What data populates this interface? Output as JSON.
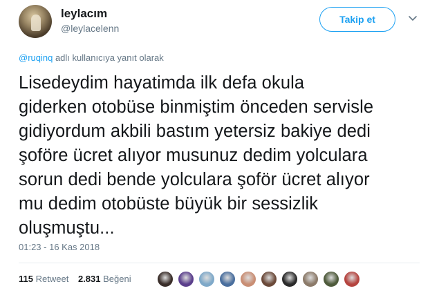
{
  "user": {
    "display_name": "leylacım",
    "handle": "@leylacelenn"
  },
  "follow_button": {
    "label": "Takip et"
  },
  "reply_context": {
    "mention": "@ruqinq",
    "suffix": " adlı kullanıcıya yanıt olarak"
  },
  "tweet": {
    "text": "Lisedeydim hayatimda ilk defa okula\ngiderken otobüse binmiştim önceden servisle\ngidiyordum akbili bastım yetersiz bakiye dedi\nşoföre ücret alıyor musunuz dedim yolculara\nsorun dedi bende yolculara şoför ücret alıyor\nmu dedim otobüste büyük bir sessizlik\noluşmuştu...",
    "timestamp": "01:23 - 16 Kas 2018"
  },
  "stats": {
    "retweet_count": "115",
    "retweet_label": "Retweet",
    "like_count": "2.831",
    "like_label": "Beğeni"
  },
  "colors": {
    "accent": "#1da1f2",
    "secondary_text": "#657786",
    "divider": "#e6ecf0"
  },
  "icons": {
    "menu": "chevron-down-icon"
  },
  "likers": [
    {
      "name": "liker-avatar",
      "color": "#3a2e2a"
    },
    {
      "name": "liker-avatar",
      "color": "#5b3f8c"
    },
    {
      "name": "liker-avatar",
      "color": "#7fa9c9"
    },
    {
      "name": "liker-avatar",
      "color": "#4a6f9e"
    },
    {
      "name": "liker-avatar",
      "color": "#c98e74"
    },
    {
      "name": "liker-avatar",
      "color": "#6b4a3a"
    },
    {
      "name": "liker-avatar",
      "color": "#2b2b2b"
    },
    {
      "name": "liker-avatar",
      "color": "#8c7b6a"
    },
    {
      "name": "liker-avatar",
      "color": "#4f5b3c"
    },
    {
      "name": "liker-avatar",
      "color": "#b5443f"
    }
  ]
}
